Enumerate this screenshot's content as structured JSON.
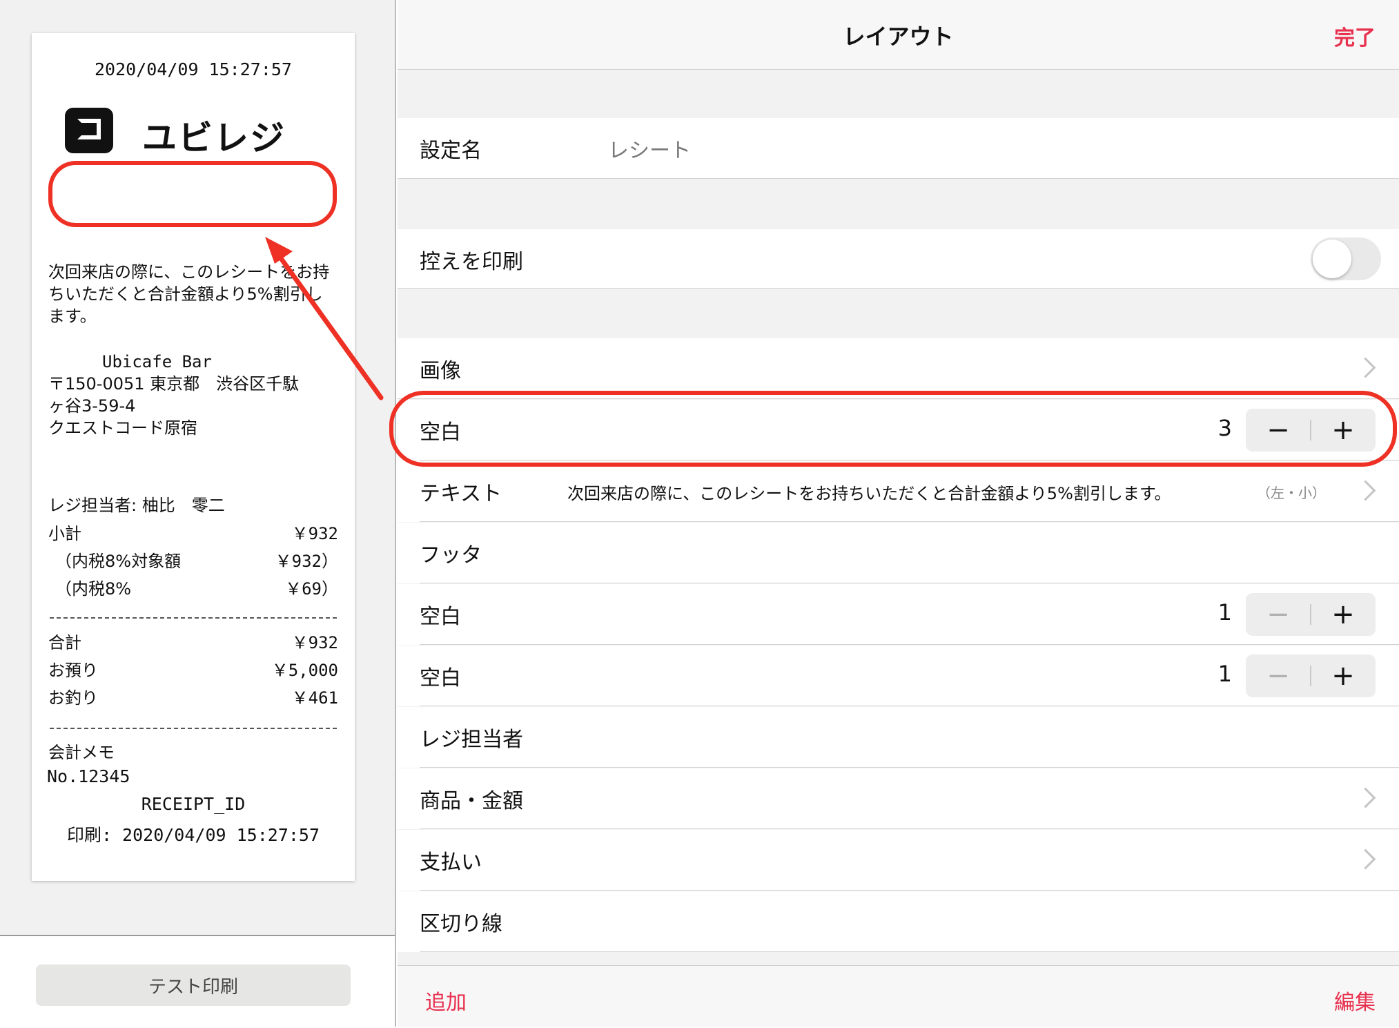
{
  "preview": {
    "datetime": "2020/04/09 15:27:57",
    "logo_text": "ユビレジ",
    "note": "次回来店の際に、このレシートをお持ちいただくと合計金額より5%割引します。",
    "store_name": "Ubicafe Bar",
    "address_line1": "〒150-0051 東京都　渋谷区千駄",
    "address_line2": "ヶ谷3-59-4",
    "address_line3": "クエストコード原宿",
    "cashier": "レジ担当者: 柚比　零二",
    "totals": [
      {
        "label": "小計",
        "value": "￥932"
      },
      {
        "label": "（内税8%対象額",
        "value": "￥932）"
      },
      {
        "label": "（内税8%",
        "value": "￥69）"
      }
    ],
    "payments": [
      {
        "label": "合計",
        "value": "￥932"
      },
      {
        "label": "お預り",
        "value": "￥5,000"
      },
      {
        "label": "お釣り",
        "value": "￥461"
      }
    ],
    "memo_label": "会計メモ",
    "memo_value": "No.12345",
    "receipt_id": "RECEIPT_ID",
    "printed": "印刷: 2020/04/09 15:27:57"
  },
  "test_print_label": "テスト印刷",
  "nav": {
    "title": "レイアウト",
    "done": "完了"
  },
  "settings": {
    "setting_name_label": "設定名",
    "setting_name_value": "レシート",
    "print_copy_label": "控えを印刷",
    "print_copy_on": false
  },
  "layout_items": [
    {
      "label": "画像"
    },
    {
      "label": "空白",
      "count": "3"
    },
    {
      "label": "テキスト",
      "text": "次回来店の際に、このレシートをお持ちいただくと合計金額より5%割引します。",
      "sub": "（左・小）"
    },
    {
      "label": "フッタ"
    },
    {
      "label": "空白",
      "count": "1"
    },
    {
      "label": "空白",
      "count": "1"
    },
    {
      "label": "レジ担当者"
    },
    {
      "label": "商品・金額"
    },
    {
      "label": "支払い"
    },
    {
      "label": "区切り線"
    }
  ],
  "stepper": {
    "minus": "−",
    "plus": "+"
  },
  "bottom": {
    "add": "追加",
    "edit": "編集"
  },
  "colors": {
    "accent": "#e8304f",
    "highlight": "#ee3124"
  }
}
